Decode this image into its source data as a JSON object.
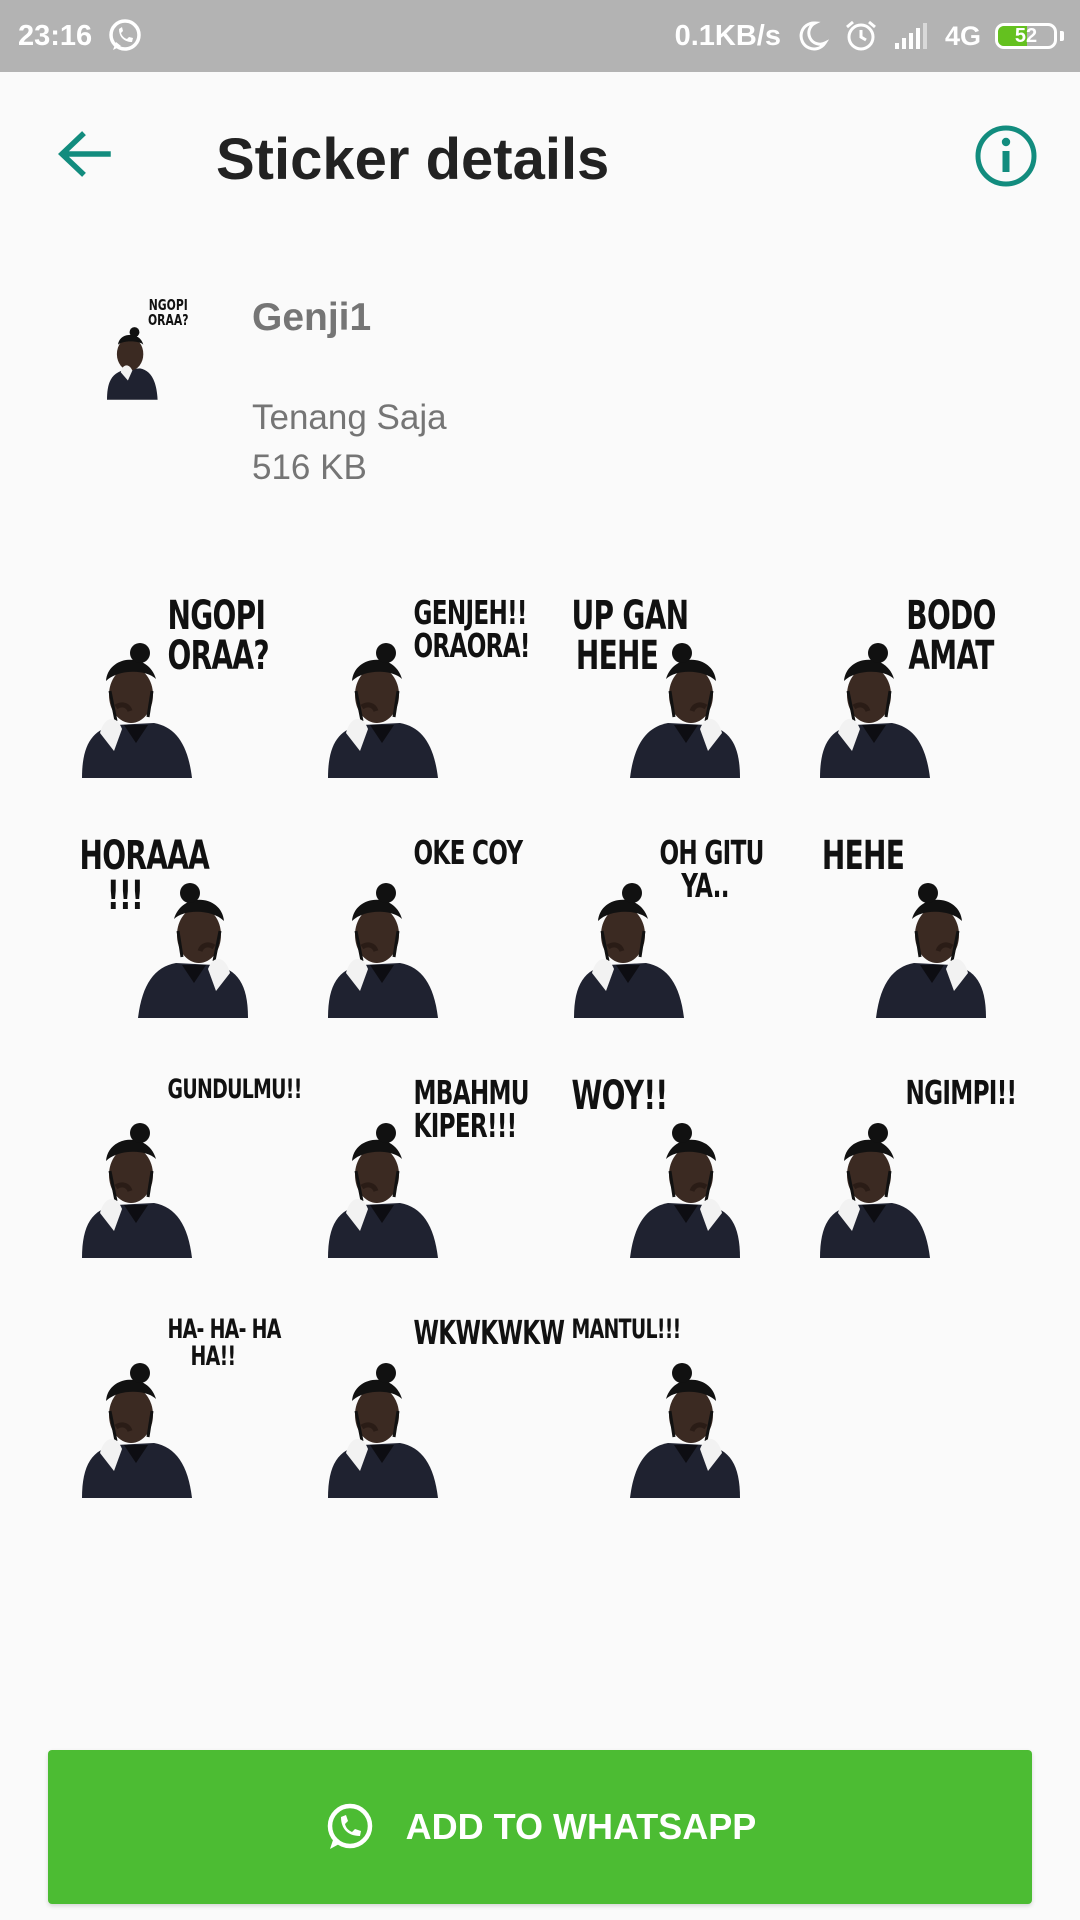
{
  "status_bar": {
    "time": "23:16",
    "net_speed": "0.1KB/s",
    "network": "4G",
    "battery": "52",
    "battery_level": 0.52
  },
  "app_bar": {
    "title": "Sticker details"
  },
  "pack": {
    "name": "Genji1",
    "publisher": "Tenang Saja",
    "size": "516 KB",
    "tray_caption": "NGOPI\nORAA?"
  },
  "stickers": [
    {
      "caption": "NGOPI\nORAA?",
      "side": "left"
    },
    {
      "caption": "GENJEH!!\nORAORA!",
      "side": "left"
    },
    {
      "caption": "UP GAN\nHEHE",
      "side": "right"
    },
    {
      "caption": "BODO\nAMAT",
      "side": "left"
    },
    {
      "caption": "HORAAA\n!!!",
      "side": "right"
    },
    {
      "caption": "OKE COY",
      "side": "left"
    },
    {
      "caption": "OH GITU\nYA..",
      "side": "left"
    },
    {
      "caption": "HEHE",
      "side": "right"
    },
    {
      "caption": "GUNDULMU!!",
      "side": "left"
    },
    {
      "caption": "MBAHMU\nKIPER!!!",
      "side": "left"
    },
    {
      "caption": "WOY!!",
      "side": "right"
    },
    {
      "caption": "NGIMPI!!",
      "side": "left"
    },
    {
      "caption": "HA- HA- HA\nHA!!",
      "side": "left"
    },
    {
      "caption": "WKWKWKW",
      "side": "left"
    },
    {
      "caption": "MANTUL!!!",
      "side": "right"
    }
  ],
  "add_button": {
    "label": "ADD TO WHATSAPP"
  },
  "colors": {
    "accent": "#128c7e",
    "button": "#4cbc33",
    "status_bar": "#b3b3b3"
  },
  "icons": {
    "back": "arrow-left-icon",
    "info": "info-icon",
    "whatsapp": "whatsapp-icon"
  }
}
